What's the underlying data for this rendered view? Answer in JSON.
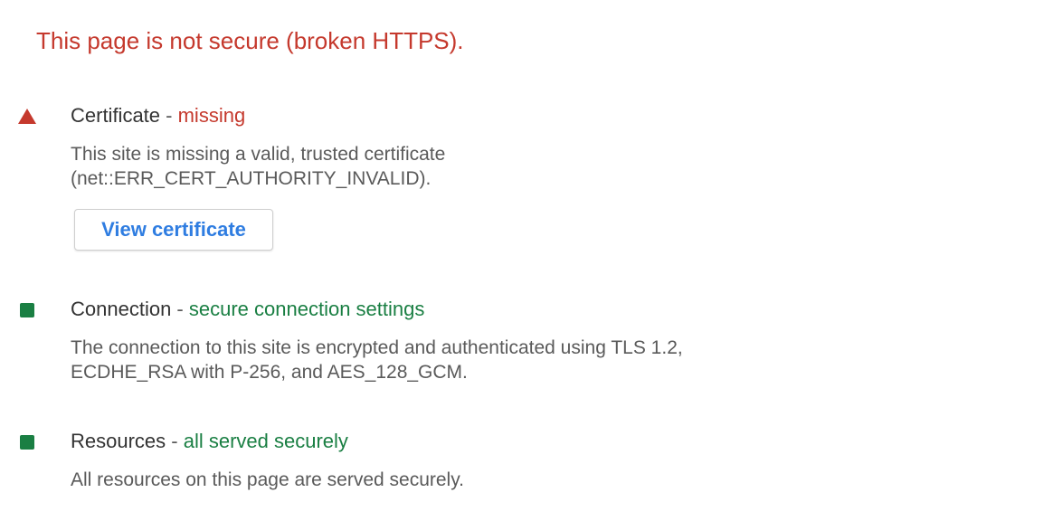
{
  "summary": "This page is not secure (broken HTTPS).",
  "colors": {
    "warning": "#c5392d",
    "secure": "#1a7f43",
    "link": "#2f7de1"
  },
  "sections": {
    "certificate": {
      "indicator_icon": "red-triangle-warning-icon",
      "title": "Certificate",
      "separator": " - ",
      "status": "missing",
      "description_lines": [
        "This site is missing a valid, trusted certificate",
        "(net::ERR_CERT_AUTHORITY_INVALID)."
      ],
      "button_label": "View certificate"
    },
    "connection": {
      "indicator_icon": "green-square-secure-icon",
      "title": "Connection",
      "separator": " - ",
      "status": "secure connection settings",
      "description_lines": [
        "The connection to this site is encrypted and authenticated using TLS 1.2,",
        "ECDHE_RSA with P-256, and AES_128_GCM."
      ]
    },
    "resources": {
      "indicator_icon": "green-square-secure-icon",
      "title": "Resources",
      "separator": " - ",
      "status": "all served securely",
      "description_lines": [
        "All resources on this page are served securely."
      ]
    }
  }
}
